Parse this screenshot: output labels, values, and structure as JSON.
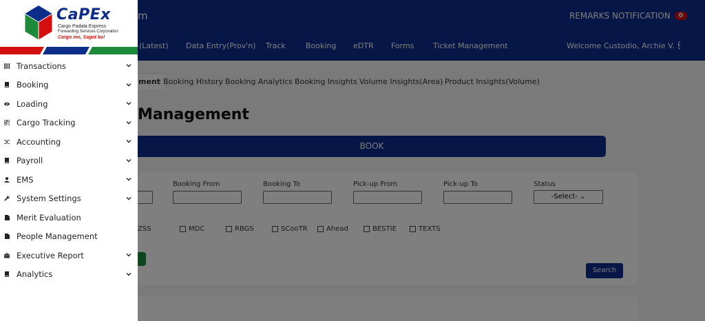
{
  "header": {
    "title_partial": "m",
    "remarks_label": "REMARKS NOTIFICATION",
    "remarks_count": "0",
    "welcome": "Welcome Custodio, Archie V. !",
    "nav": [
      {
        "label": "(Latest)"
      },
      {
        "label": "Data Entry(Prov'n)"
      },
      {
        "label": "Track"
      },
      {
        "label": "Booking"
      },
      {
        "label": "eDTR"
      },
      {
        "label": "Forms"
      },
      {
        "label": "Ticket Management"
      }
    ]
  },
  "subtabs": [
    {
      "label": "ment"
    },
    {
      "label": "Booking History"
    },
    {
      "label": "Booking Analytics"
    },
    {
      "label": "Booking Insights"
    },
    {
      "label": "Volume Insights(Area)"
    },
    {
      "label": "Product Insights(Volume)"
    }
  ],
  "page_heading": "Management",
  "book_button": "BOOK",
  "filters": {
    "labels": [
      "Booking From",
      "Booking To",
      "Pick-up From",
      "Pick-up To",
      "Status"
    ],
    "status_value": "-Select-",
    "checkboxes": [
      "ZSS",
      "MDC",
      "RBGS",
      "SCooTR",
      "Ahead",
      "BESTIE",
      "TEXTS"
    ],
    "search_label": "Search"
  },
  "logo": {
    "name": "CaPEx",
    "sub1": "Cargo Padala Express",
    "sub2": "Forwarding Services Corporation",
    "tagline": "Cargo mo, Sagot ko!"
  },
  "sidebar": {
    "items": [
      {
        "label": "Transactions",
        "icon": "barcode-icon",
        "expandable": true
      },
      {
        "label": "Booking",
        "icon": "book-icon",
        "expandable": true
      },
      {
        "label": "Loading",
        "icon": "eye-icon",
        "expandable": true
      },
      {
        "label": "Cargo Tracking",
        "icon": "qr-icon",
        "expandable": true
      },
      {
        "label": "Accounting",
        "icon": "shuffle-icon",
        "expandable": true
      },
      {
        "label": "Payroll",
        "icon": "book-icon",
        "expandable": true
      },
      {
        "label": "EMS",
        "icon": "user-icon",
        "expandable": true
      },
      {
        "label": "System Settings",
        "icon": "wrench-icon",
        "expandable": true
      },
      {
        "label": "Merit Evaluation",
        "icon": "file-icon",
        "expandable": false
      },
      {
        "label": "People Management",
        "icon": "file-icon",
        "expandable": false
      },
      {
        "label": "Executive Report",
        "icon": "briefcase-icon",
        "expandable": true
      },
      {
        "label": "Analytics",
        "icon": "book-icon",
        "expandable": true
      }
    ]
  },
  "colors": {
    "primary": "#0a2d8e",
    "accent_red": "#d40f0f",
    "accent_green": "#1c8a3a"
  }
}
